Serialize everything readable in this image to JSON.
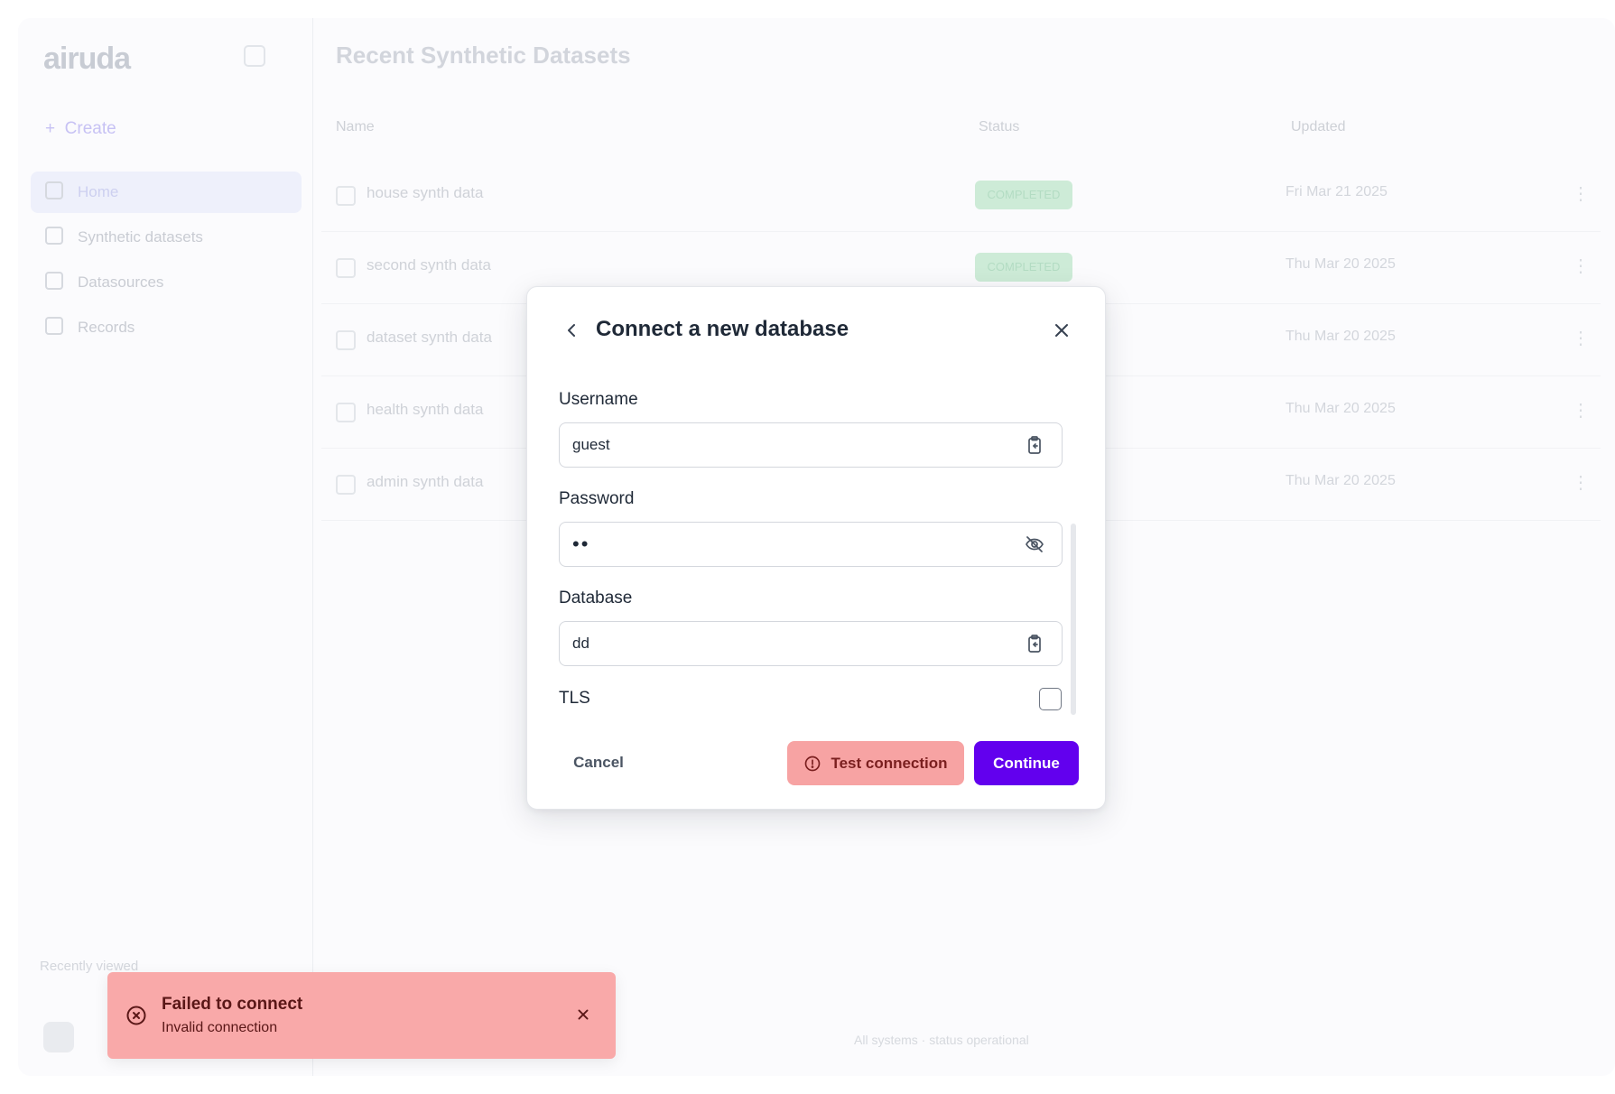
{
  "background": {
    "logo": "airuda",
    "sidebar": {
      "create_label": "Create",
      "items": [
        {
          "label": "Home"
        },
        {
          "label": "Synthetic datasets"
        },
        {
          "label": "Datasources"
        },
        {
          "label": "Records"
        }
      ],
      "recently_label": "Recently viewed"
    },
    "main": {
      "title": "Recent Synthetic Datasets",
      "columns": [
        "Name",
        "Status",
        "Updated"
      ],
      "rows": [
        {
          "name": "house synth data",
          "status": "COMPLETED",
          "date": "Fri Mar 21 2025"
        },
        {
          "name": "second synth data",
          "status": "COMPLETED",
          "date": "Thu Mar 20 2025"
        },
        {
          "name": "dataset synth data",
          "status": "",
          "date": "Thu Mar 20 2025"
        },
        {
          "name": "health synth data",
          "status": "",
          "date": "Thu Mar 20 2025"
        },
        {
          "name": "admin synth data",
          "status": "",
          "date": "Thu Mar 20 2025"
        }
      ],
      "footer": "All systems · status operational"
    }
  },
  "modal": {
    "title": "Connect a new database",
    "username": {
      "label": "Username",
      "value": "guest"
    },
    "password": {
      "label": "Password",
      "value": "••"
    },
    "database": {
      "label": "Database",
      "value": "dd"
    },
    "tls": {
      "label": "TLS",
      "checked": false
    },
    "buttons": {
      "cancel": "Cancel",
      "test": "Test connection",
      "continue": "Continue"
    }
  },
  "toast": {
    "title": "Failed to connect",
    "message": "Invalid connection"
  },
  "colors": {
    "primary": "#6200ee",
    "error_bg": "#f7a3a3",
    "error_text": "#7a1f1f"
  },
  "icons": {
    "back": "chevron-left-icon",
    "close": "close-icon",
    "paste": "clipboard-icon",
    "hide_password": "eye-off-icon",
    "alert": "alert-circle-icon",
    "error": "x-circle-icon"
  }
}
